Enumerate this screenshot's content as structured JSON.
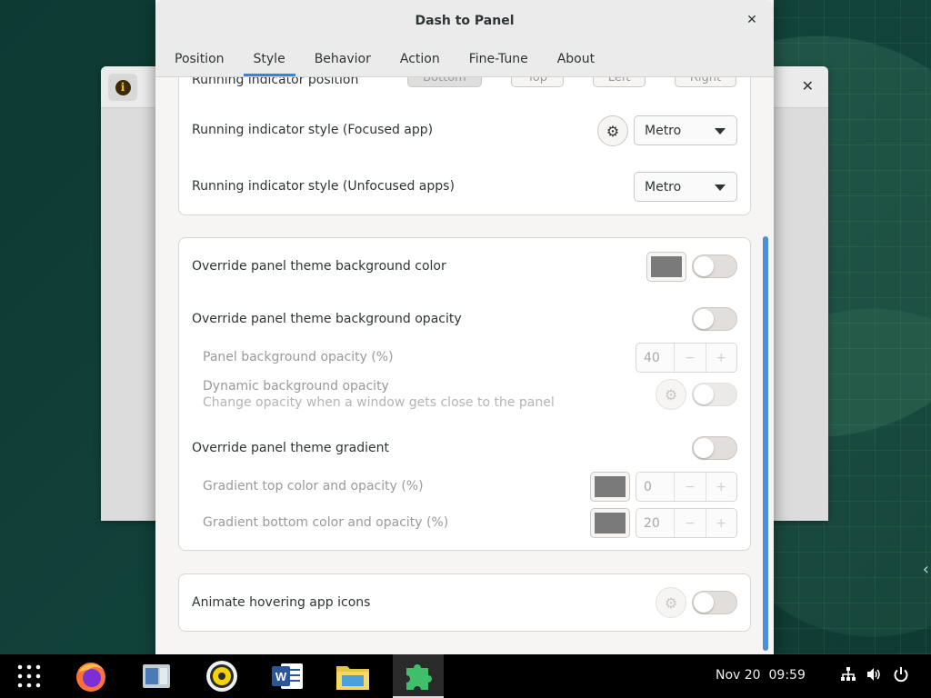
{
  "window": {
    "title": "Dash to Panel",
    "close_glyph": "✕"
  },
  "tabs": [
    {
      "label": "Position"
    },
    {
      "label": "Style",
      "active": true
    },
    {
      "label": "Behavior"
    },
    {
      "label": "Action"
    },
    {
      "label": "Fine-Tune"
    },
    {
      "label": "About"
    }
  ],
  "indicator": {
    "position_label": "Running indicator position",
    "position_options": [
      "Bottom",
      "Top",
      "Left",
      "Right"
    ],
    "focused_label": "Running indicator style (Focused app)",
    "focused_value": "Metro",
    "unfocused_label": "Running indicator style (Unfocused apps)",
    "unfocused_value": "Metro"
  },
  "background": {
    "color_label": "Override panel theme background color",
    "opacity_label": "Override panel theme background opacity",
    "panel_opacity_label": "Panel background opacity (%)",
    "panel_opacity_value": "40",
    "dynamic_label": "Dynamic background opacity",
    "dynamic_sublabel": "Change opacity when a window gets close to the panel",
    "gradient_label": "Override panel theme gradient",
    "gradient_top_label": "Gradient top color and opacity (%)",
    "gradient_top_value": "0",
    "gradient_bottom_label": "Gradient bottom color and opacity (%)",
    "gradient_bottom_value": "20",
    "swatch_color": "#7a7a7a"
  },
  "animate": {
    "label": "Animate hovering app icons"
  },
  "spin_glyphs": {
    "minus": "−",
    "plus": "+"
  },
  "taskbar": {
    "date": "Nov 20",
    "time": "09:59",
    "apps": [
      "app-grid-icon",
      "firefox-icon",
      "file-manager-icon",
      "music-player-icon",
      "word-icon",
      "files-icon",
      "extensions-icon"
    ]
  },
  "colors": {
    "accent": "#3584e4",
    "scrollbar": "#4a90d9",
    "taskbar": "#000000"
  }
}
